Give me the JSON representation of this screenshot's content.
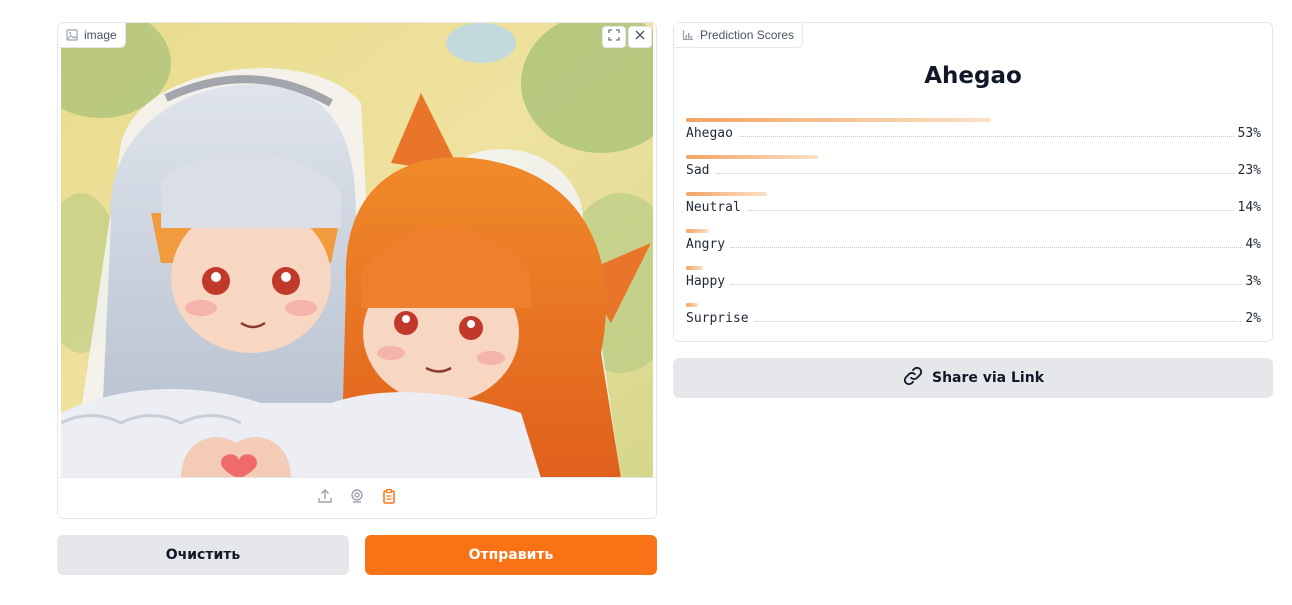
{
  "input_panel": {
    "label": "image",
    "label_icon": "image-icon",
    "tools": [
      "fullscreen-icon",
      "close-icon"
    ],
    "source_icons": [
      "upload-icon",
      "webcam-icon",
      "clipboard-icon"
    ],
    "picture_alt": "Illustration of two anime girls in wedding veils, one with silver hair and one with orange hair and fox ears, making a heart shape with their hands"
  },
  "buttons": {
    "clear": "Очистить",
    "submit": "Отправить"
  },
  "output_panel": {
    "label": "Prediction Scores",
    "label_icon": "bar-chart-icon",
    "top_label": "Ahegao",
    "scores": [
      {
        "label": "Ahegao",
        "value": "53%",
        "fraction": 0.53
      },
      {
        "label": "Sad",
        "value": "23%",
        "fraction": 0.23
      },
      {
        "label": "Neutral",
        "value": "14%",
        "fraction": 0.14
      },
      {
        "label": "Angry",
        "value": "4%",
        "fraction": 0.04
      },
      {
        "label": "Happy",
        "value": "3%",
        "fraction": 0.03
      },
      {
        "label": "Surprise",
        "value": "2%",
        "fraction": 0.02
      }
    ]
  },
  "share": {
    "label": "Share via Link",
    "icon": "link-icon"
  },
  "colors": {
    "accent": "#f97316",
    "button_gray": "#e5e7eb",
    "border": "#e5e7eb"
  }
}
